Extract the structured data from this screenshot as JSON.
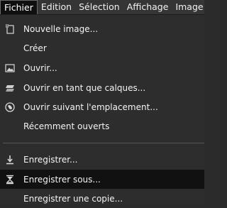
{
  "menubar": {
    "items": [
      {
        "label": "Fichier"
      },
      {
        "label": "Edition"
      },
      {
        "label": "Sélection"
      },
      {
        "label": "Affichage"
      },
      {
        "label": "Image"
      }
    ]
  },
  "file_menu": {
    "items": [
      {
        "label": "Nouvelle image...",
        "icon": "new-image-icon"
      },
      {
        "label": "Créer",
        "icon": ""
      },
      {
        "label": "Ouvrir...",
        "icon": "open-image-icon"
      },
      {
        "label": "Ouvrir en tant que calques...",
        "icon": "open-as-layers-icon"
      },
      {
        "label": "Ouvrir suivant l'emplacement...",
        "icon": "open-location-icon"
      },
      {
        "label": "Récemment ouverts",
        "icon": ""
      },
      {
        "label": "Enregistrer...",
        "icon": "save-icon"
      },
      {
        "label": "Enregistrer sous...",
        "icon": "save-as-icon"
      },
      {
        "label": "Enregistrer une copie...",
        "icon": ""
      }
    ],
    "highlighted_index": 7
  },
  "colors": {
    "menubar_bg": "#353535",
    "menu_bg": "#2d2d2d",
    "highlight_bg": "#111111",
    "text": "#ffffff"
  }
}
